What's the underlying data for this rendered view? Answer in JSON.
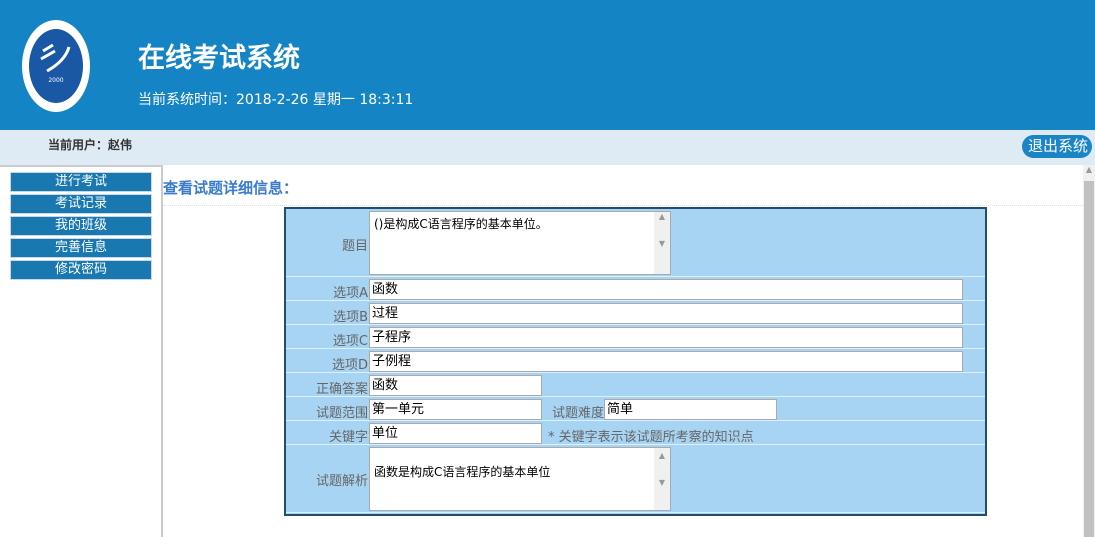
{
  "header": {
    "title": "在线考试系统",
    "clock": "当前系统时间：2018-2-26 星期一 18:3:11",
    "logo_text": "ANHUI XINHUA UNIVERSITY 2000 安徽新华学院"
  },
  "userbar": {
    "user": "当前用户：赵伟",
    "logout": "退出系统"
  },
  "sidebar": {
    "items": [
      {
        "label": "进行考试"
      },
      {
        "label": "考试记录"
      },
      {
        "label": "我的班级"
      },
      {
        "label": "完善信息"
      },
      {
        "label": "修改密码"
      }
    ]
  },
  "main": {
    "title": "查看试题详细信息：",
    "form": {
      "question_label": "题目",
      "question": "()是构成C语言程序的基本单位。",
      "a_label": "选项A",
      "a": "函数",
      "b_label": "选项B",
      "b": "过程",
      "c_label": "选项C",
      "c": "子程序",
      "d_label": "选项D",
      "d": "子例程",
      "answer_label": "正确答案",
      "answer": "函数",
      "scope_label": "试题范围",
      "scope": "第一单元",
      "difficulty_label": "试题难度",
      "difficulty": "简单",
      "keyword_label": "关键字",
      "keyword": "单位",
      "keyword_hint": "* 关键字表示该试题所考察的知识点",
      "analysis_label": "试题解析",
      "analysis": "函数是构成C语言程序的基本单位"
    }
  },
  "colors": {
    "header": "#1484c4",
    "userbar": "#deebf5",
    "nav": "#1a78b0",
    "form": "#a8d4f3",
    "title": "#3b7bd0"
  }
}
